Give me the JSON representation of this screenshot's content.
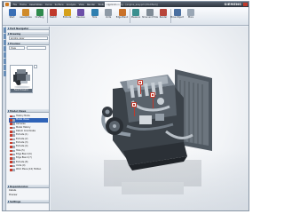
{
  "titlebar": {
    "title": "NX 7 - Modeling - [engine_assy.prt (Modified)]",
    "brand": "SIEMENS",
    "menu": [
      "File",
      "Home",
      "Assemblies",
      "Curve",
      "Surface",
      "Analysis",
      "View",
      "Render",
      "Tools",
      "Application"
    ],
    "active_menu_index": 9
  },
  "ribbon": {
    "buttons": [
      {
        "label": "Start",
        "color": "#3a6fb5"
      },
      {
        "label": "Assemblies",
        "color": "#d08b2a"
      },
      {
        "label": "Drafting",
        "color": "#2f8a4d"
      },
      {
        "label": "Sketch",
        "color": "#c0392b"
      },
      {
        "label": "Extrude",
        "color": "#d5a11c"
      },
      {
        "label": "Revolve",
        "color": "#6c4fa8"
      },
      {
        "label": "Hole",
        "color": "#2e7fb0"
      },
      {
        "label": "Unite",
        "color": "#8e9aa6"
      },
      {
        "label": "Edge Blend",
        "color": "#c9722a"
      },
      {
        "label": "Measure",
        "color": "#3a8f8f"
      },
      {
        "label": "Show and Hide",
        "color": "#7f8b96"
      },
      {
        "label": "Render",
        "color": "#b8453a"
      },
      {
        "label": "Move Object",
        "color": "#4a6fa0"
      },
      {
        "label": "More",
        "color": "#9aa7b5"
      }
    ]
  },
  "panel": {
    "header": "Part Navigator",
    "section1": "Drawing",
    "part_field": "engine_assy",
    "section2": "Preview",
    "view_field": "View",
    "thumbnail_caption": "Front Trimetric",
    "section3": "Model Views",
    "tree": [
      {
        "label": "History Mode",
        "selected": false
      },
      {
        "label": "Model Views",
        "selected": true
      },
      {
        "label": "Cameras",
        "selected": false
      },
      {
        "label": "Model History",
        "selected": false
      },
      {
        "label": "Datum Coordinate",
        "selected": false
      },
      {
        "label": "Extrude (1)",
        "selected": false
      },
      {
        "label": "Extrude (2)",
        "selected": false
      },
      {
        "label": "Extrude (3)",
        "selected": false
      },
      {
        "label": "Extrude (4)",
        "selected": false
      },
      {
        "label": "Hole (5)",
        "selected": false
      },
      {
        "label": "Edge Blend (6)",
        "selected": false
      },
      {
        "label": "Edge Blend (7)",
        "selected": false
      },
      {
        "label": "Extrude (8)",
        "selected": false
      },
      {
        "label": "Unite (9)",
        "selected": false
      },
      {
        "label": "Work Plane (10) Hidden",
        "selected": false
      }
    ],
    "dependencies": "Dependencies",
    "details": "Details",
    "preview": "Preview",
    "settings": "Settings"
  },
  "colors": {
    "accent": "#2f63b8",
    "brand_orange": "#d07a1e",
    "tag_red": "#c0392b"
  }
}
